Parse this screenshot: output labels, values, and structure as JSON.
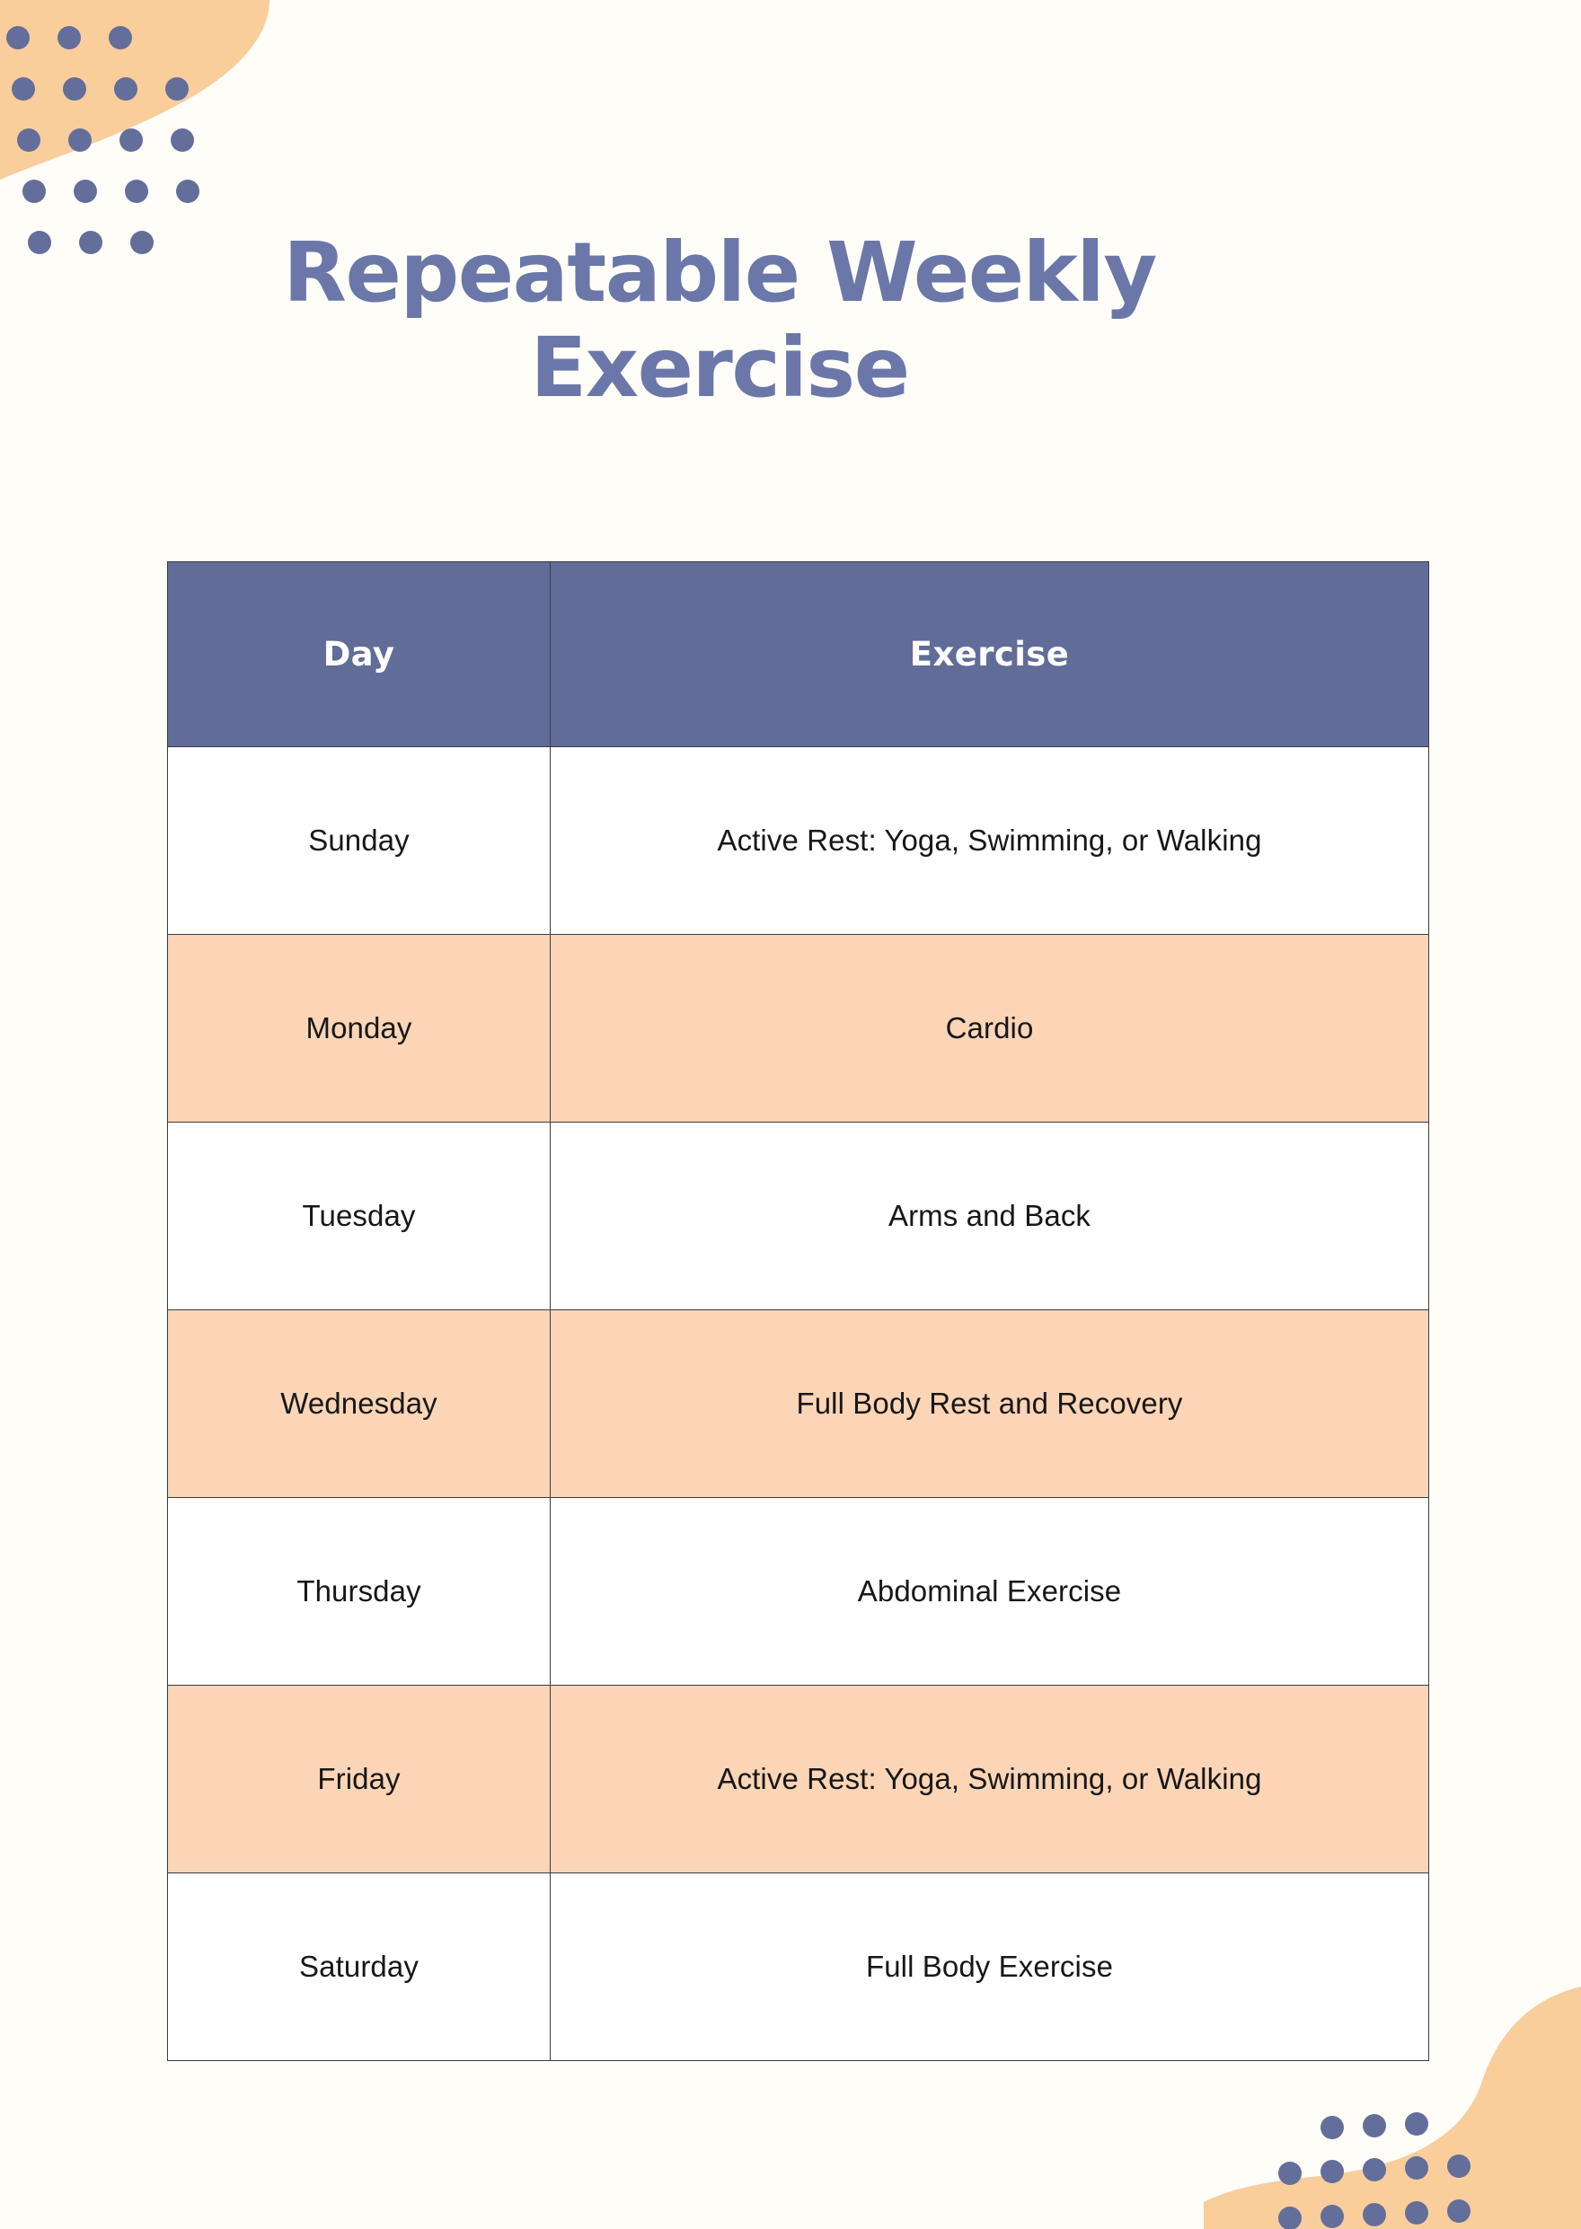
{
  "document": {
    "title_line_1": "Repeatable Weekly",
    "title_line_2": "Exercise"
  },
  "colors": {
    "background": "#FEFDF8",
    "title_text": "#6B77A8",
    "header_background": "#626C98",
    "header_text": "#FFFFFF",
    "row_white": "#FFFFFF",
    "row_peach": "#FBD5B5",
    "blob_peach": "#F9CE9B",
    "dot_blue": "#646E9B",
    "table_border": "#3B3B44"
  },
  "table": {
    "columns": [
      "Day",
      "Exercise"
    ],
    "rows": [
      {
        "day": "Sunday",
        "exercise": "Active Rest: Yoga, Swimming, or Walking",
        "shade": "white"
      },
      {
        "day": "Monday",
        "exercise": "Cardio",
        "shade": "peach"
      },
      {
        "day": "Tuesday",
        "exercise": "Arms and Back",
        "shade": "white"
      },
      {
        "day": "Wednesday",
        "exercise": "Full Body Rest and Recovery",
        "shade": "peach"
      },
      {
        "day": "Thursday",
        "exercise": "Abdominal Exercise",
        "shade": "white"
      },
      {
        "day": "Friday",
        "exercise": "Active Rest: Yoga, Swimming, or Walking",
        "shade": "peach"
      },
      {
        "day": "Saturday",
        "exercise": "Full Body Exercise",
        "shade": "white"
      }
    ]
  },
  "decorations": {
    "top_left": {
      "name": "peach-blob-dot-grid",
      "dot_rows": [
        {
          "count": 3,
          "offset": 0
        },
        {
          "count": 4,
          "offset": 1
        },
        {
          "count": 4,
          "offset": 1
        },
        {
          "count": 4,
          "offset": 2
        },
        {
          "count": 3,
          "offset": 2
        }
      ]
    },
    "bottom_right": {
      "name": "peach-blob-dot-grid",
      "dot_rows": [
        {
          "count": 3,
          "offset": 2
        },
        {
          "count": 5,
          "offset": 0
        },
        {
          "count": 5,
          "offset": 0
        }
      ]
    }
  }
}
